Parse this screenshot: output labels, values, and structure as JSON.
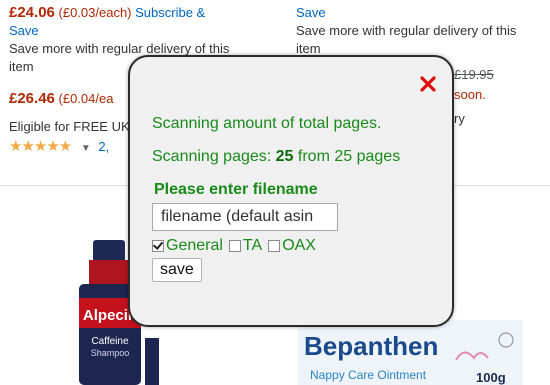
{
  "background": {
    "left_col": {
      "price1": "£24.06",
      "unit1": "(£0.03/each)",
      "subscribe": "Subscribe &",
      "save_word": "Save",
      "regular_line1": "Save more with regular delivery of this",
      "regular_line2": "item",
      "price2": "£26.46",
      "unit2": "(£0.04/ea",
      "free_uk": "Eligible for FREE UK",
      "rating_count": "2,"
    },
    "right_col": {
      "save_link": "Save",
      "regular_line1": "Save more with regular delivery of this",
      "regular_line2": "item",
      "old_price": "£19.95",
      "soon": "soon.",
      "delivery_frag": "ry"
    },
    "products": {
      "alpecin_brand": "Alpecin",
      "alpecin_line1": "Caffeine",
      "alpecin_line2": "Shampoo",
      "bepa_brand": "Bepanthen",
      "bepa_sub": "Nappy Care Ointment",
      "bepa_size": "100g"
    }
  },
  "modal": {
    "scanning_total": "Scanning amount of total pages.",
    "scanning_prefix": "Scanning pages:",
    "scanning_current": "25",
    "scanning_suffix": "from 25 pages",
    "filename_label": "Please enter filename",
    "filename_value": "filename (default asin",
    "checkboxes": [
      {
        "label": "General",
        "checked": true
      },
      {
        "label": "TA",
        "checked": false
      },
      {
        "label": "OAX",
        "checked": false
      }
    ],
    "save_label": "save"
  }
}
